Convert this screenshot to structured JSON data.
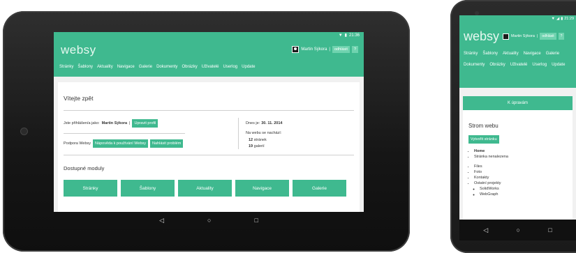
{
  "tablet": {
    "status": {
      "time": "21:36",
      "wifi_icon": "wifi-icon",
      "battery_icon": "battery-icon"
    },
    "logo": "websy",
    "user": {
      "name": "Martin Sýkora",
      "separator": "|",
      "logout": "odhlásit",
      "help": "?"
    },
    "nav": [
      "Stránky",
      "Šablony",
      "Aktuality",
      "Navigace",
      "Galerie",
      "Dokumenty",
      "Obrázky",
      "Uživatelé",
      "Userlog",
      "Update"
    ],
    "welcome_title": "Vítejte zpět",
    "logged_in_label": "Jste přihlášen/a jako:",
    "logged_in_name": "Martin Sýkora",
    "logged_in_sep": "|",
    "edit_profile": "Upravit profil",
    "support_label": "Podpora Websy",
    "help_button": "Nápověda k používání Websy",
    "report_button": "Nahlásit problém",
    "today_label": "Dnes je:",
    "today_date": "30. 11. 2014",
    "web_contains": "Na webu se nachází:",
    "pages_count": "12",
    "pages_label": "stránek",
    "galleries_count": "19",
    "galleries_label": "galerií",
    "modules_title": "Dostupné moduly",
    "modules": [
      "Stránky",
      "Šablony",
      "Aktuality",
      "Navigace",
      "Galerie"
    ],
    "navbar": {
      "back": "◁",
      "home": "○",
      "recent": "□"
    }
  },
  "phone": {
    "status": {
      "time": "21:29"
    },
    "logo": "websy",
    "user": {
      "name": "Martin Sýkora",
      "separator": "|",
      "logout": "odhlásit",
      "help": "?"
    },
    "nav": [
      "Stránky",
      "Šablony",
      "Aktuality",
      "Navigace",
      "Galerie",
      "Dokumenty",
      "Obrázky",
      "Uživatelé",
      "Userlog",
      "Update"
    ],
    "edit_bar": "K úpravám",
    "tree_title": "Strom webu",
    "create_page": "Vytvořit stránku",
    "tree_items_a": [
      "Home",
      "Stránka nenalezena"
    ],
    "tree_items_b": [
      "Files",
      "Foto",
      "Kontakty",
      "Ostatní projekty"
    ],
    "tree_sub": [
      "SolidWorks",
      "WebGraph"
    ],
    "navbar": {
      "back": "◁",
      "home": "○",
      "recent": "□"
    }
  },
  "colors": {
    "accent": "#3fb98f",
    "accent_light": "#6fd3af",
    "bezel": "#1a1a1a"
  }
}
